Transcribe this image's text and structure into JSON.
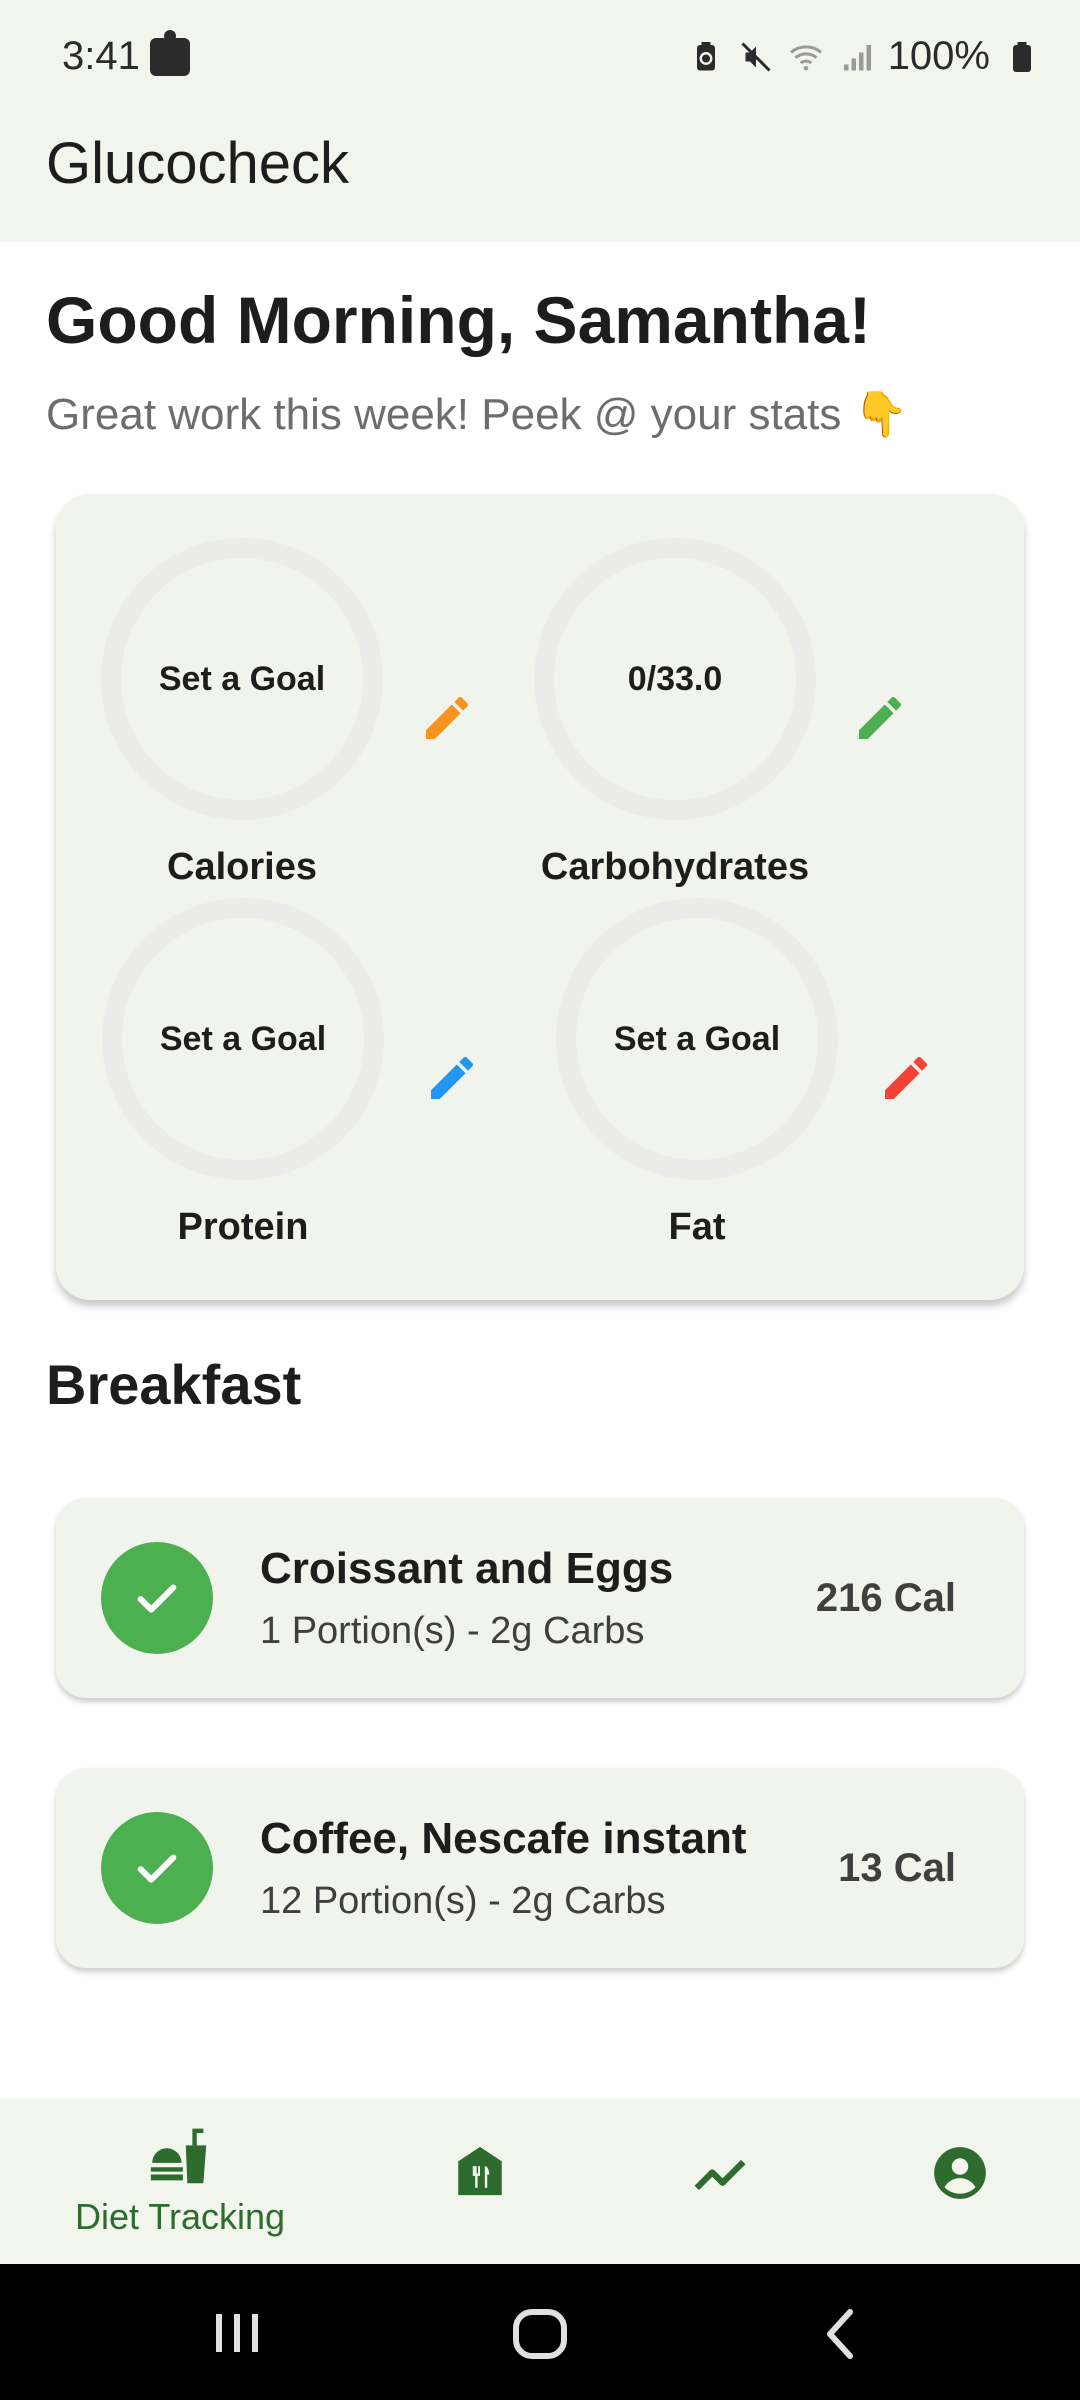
{
  "status_bar": {
    "time": "3:41",
    "battery_percent": "100%",
    "icons": [
      "puzzle-icon",
      "battery-saver-icon",
      "mute-icon",
      "wifi-icon",
      "signal-icon",
      "battery-icon"
    ]
  },
  "app_bar": {
    "title": "Glucocheck"
  },
  "greeting": {
    "title": "Good Morning, Samantha!",
    "subtitle": "Great work this week! Peek @ your stats 👇"
  },
  "stats": [
    {
      "name": "Calories",
      "ring_text": "Set a Goal",
      "pencil_color": "#f7931e"
    },
    {
      "name": "Carbohydrates",
      "ring_text": "0/33.0",
      "pencil_color": "#4caf50"
    },
    {
      "name": "Protein",
      "ring_text": "Set a Goal",
      "pencil_color": "#2196f3"
    },
    {
      "name": "Fat",
      "ring_text": "Set a Goal",
      "pencil_color": "#f44336"
    }
  ],
  "meal": {
    "title": "Breakfast",
    "items": [
      {
        "name": "Croissant and Eggs",
        "meta": "1 Portion(s) - 2g Carbs",
        "calories": "216 Cal"
      },
      {
        "name": "Coffee, Nescafe instant",
        "meta": "12 Portion(s) - 2g Carbs",
        "calories": "13 Cal"
      }
    ]
  },
  "bottom_nav": {
    "items": [
      {
        "label": "Diet Tracking",
        "icon": "diet-tracking-icon",
        "active": true
      },
      {
        "label": "",
        "icon": "restaurant-icon",
        "active": false
      },
      {
        "label": "",
        "icon": "trend-icon",
        "active": false
      },
      {
        "label": "",
        "icon": "account-icon",
        "active": false
      }
    ]
  },
  "colors": {
    "accent_green": "#2e6b2e",
    "check_green": "#4caf50",
    "surface": "#f1f4ec"
  }
}
